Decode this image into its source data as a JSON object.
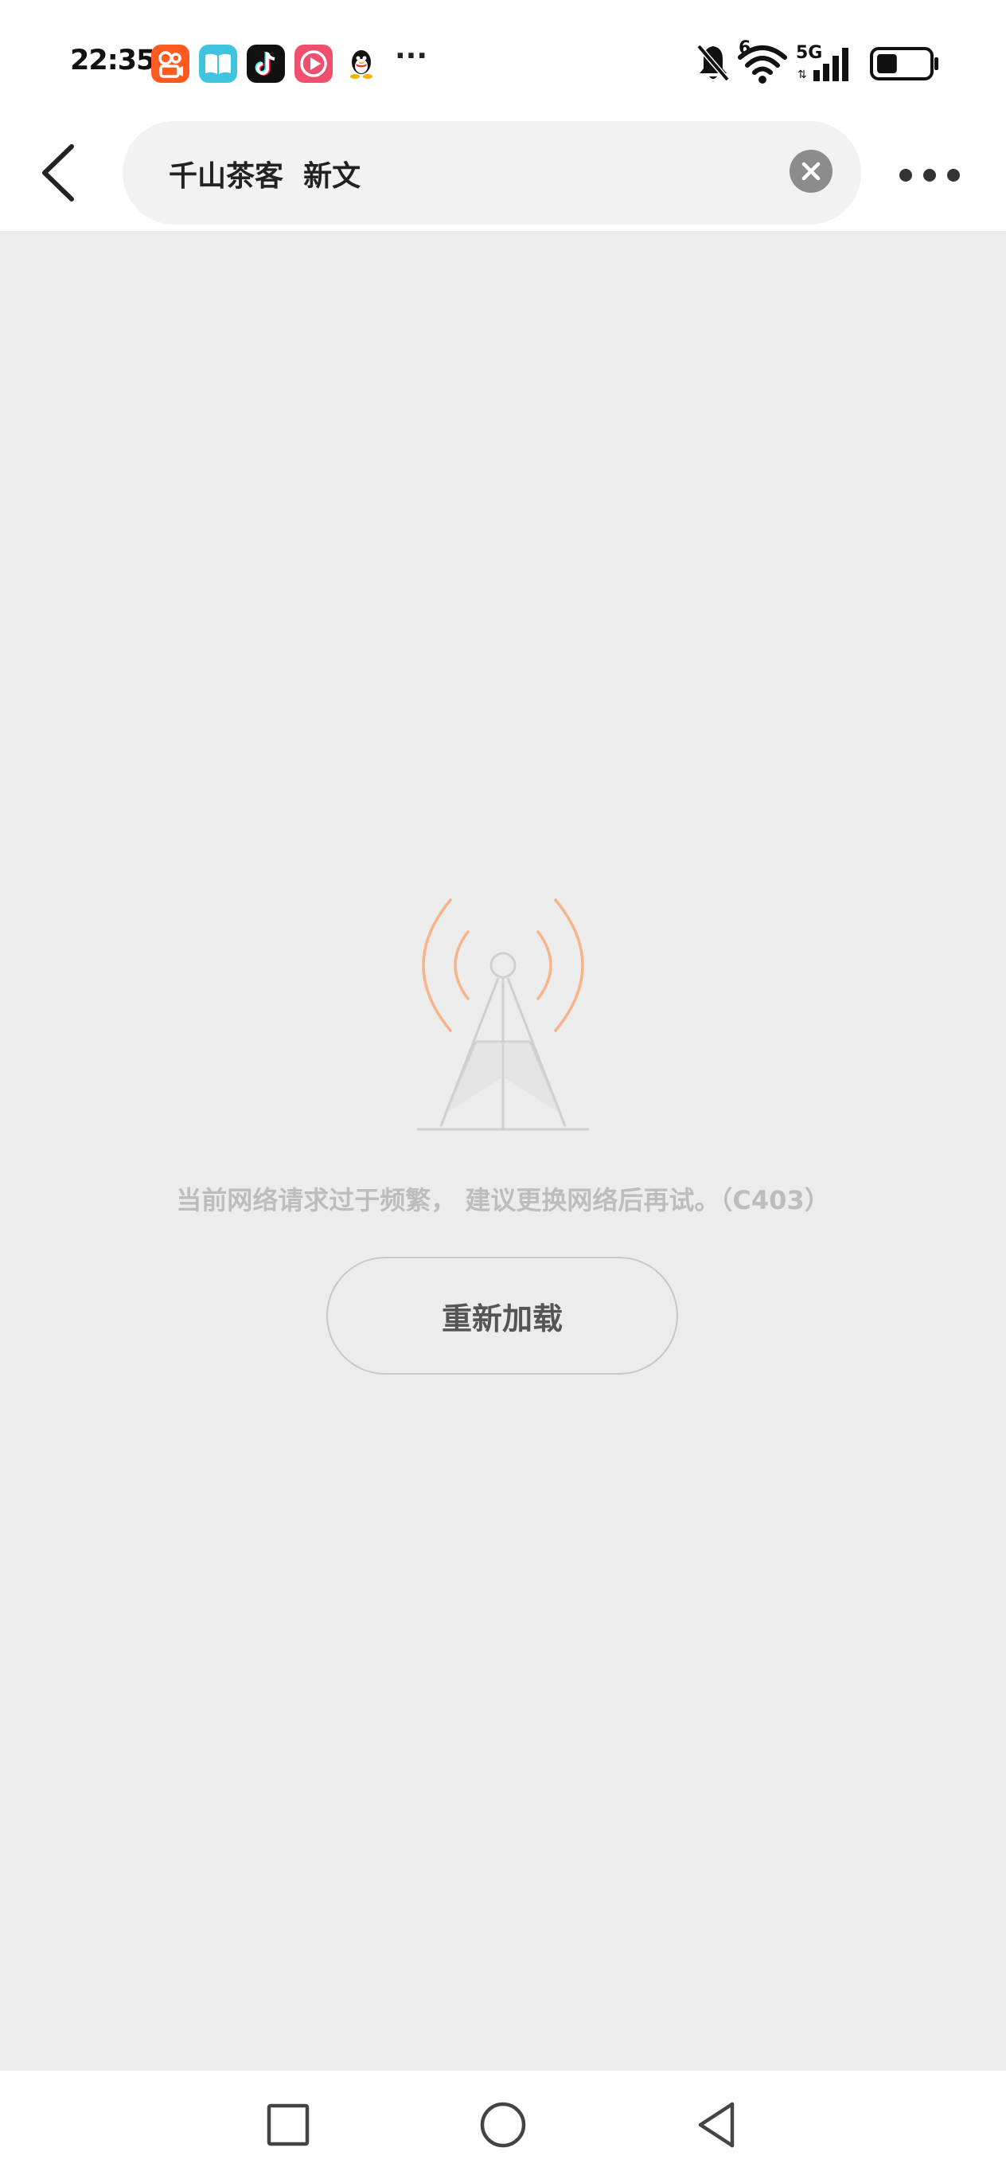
{
  "status_bar": {
    "time": "22:35",
    "notification_icons": [
      "kuaishou-app-icon",
      "reader-app-icon",
      "douyin-app-icon",
      "video-app-icon",
      "qq-app-icon"
    ],
    "more_notifications": "···",
    "wifi_badge": "6",
    "network_type": "5G",
    "battery_level": 0.4,
    "colors": {
      "kuaishou": "#ff5a1f",
      "reader": "#3fc4e0",
      "douyin": "#111111",
      "video": "#f0506e"
    }
  },
  "top_bar": {
    "search_text": "千山茶客  新文"
  },
  "content": {
    "error_message": "当前网络请求过于频繁， 建议更换网络后再试。（C403）",
    "reload_label": "重新加载",
    "colors": {
      "signal_waves": "#f7b48a",
      "tower": "#cfcfcf"
    }
  },
  "bottom_nav": {
    "buttons": [
      "recents-square-icon",
      "home-circle-icon",
      "back-triangle-icon"
    ]
  }
}
